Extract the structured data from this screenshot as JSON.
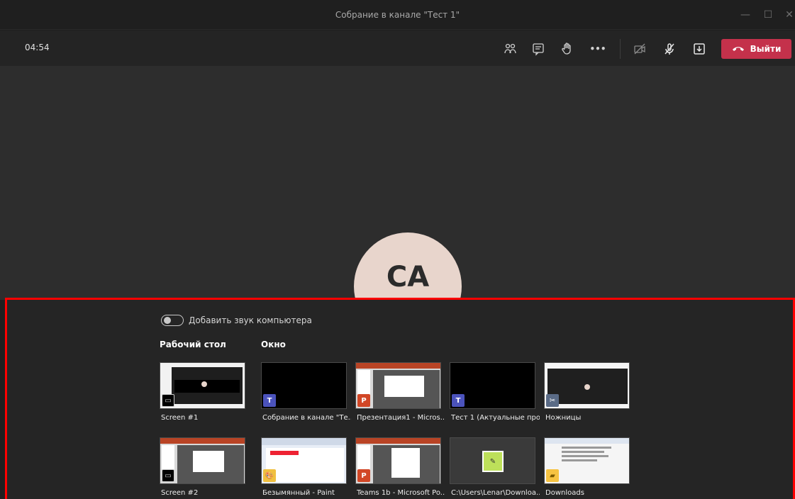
{
  "window": {
    "title": "Собрание в канале \"Тест 1\"",
    "minimize_glyph": "—",
    "maximize_glyph": "☐",
    "close_glyph": "✕"
  },
  "toolbar": {
    "timer": "04:54",
    "more_glyph": "•••",
    "leave_label": "Выйти",
    "colors": {
      "leave": "#c4314b",
      "icon": "#d0d0d0"
    }
  },
  "participant": {
    "initials": "CA",
    "avatar_color": "#e8d5cc"
  },
  "share_panel": {
    "include_audio_label": "Добавить звук компьютера",
    "include_audio_on": false,
    "desktop_section": "Рабочий стол",
    "window_section": "Окно",
    "highlight_color": "#ff0000",
    "row1": [
      {
        "label": "Screen #1",
        "kind": "screen"
      },
      {
        "label": "Собрание в канале \"Те...",
        "kind": "teams"
      },
      {
        "label": "Презентация1 - Micros...",
        "kind": "powerpoint"
      },
      {
        "label": "Тест 1 (Актуальные про...",
        "kind": "teams"
      },
      {
        "label": "Ножницы",
        "kind": "snipping"
      }
    ],
    "row2": [
      {
        "label": "Screen #2",
        "kind": "screen"
      },
      {
        "label": "Безымянный - Paint",
        "kind": "paint"
      },
      {
        "label": "Teams 1b - Microsoft Po...",
        "kind": "powerpoint"
      },
      {
        "label": "C:\\Users\\Lenar\\Downloa...",
        "kind": "notepad"
      },
      {
        "label": "Downloads",
        "kind": "explorer"
      }
    ]
  }
}
